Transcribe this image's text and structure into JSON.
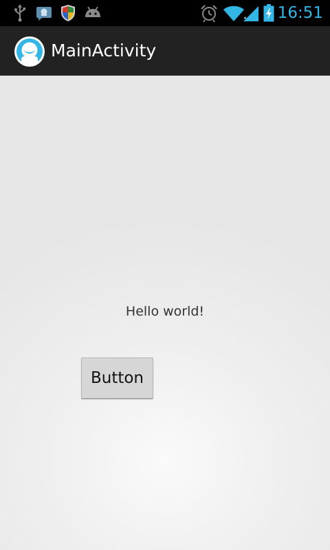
{
  "status_bar": {
    "time": "16:51",
    "left_icons": [
      "usb-icon",
      "chat-notification-icon",
      "shield-icon",
      "android-debug-icon"
    ],
    "right_icons": [
      "alarm-clock-icon",
      "wifi-icon",
      "cell-signal-icon",
      "battery-charging-icon"
    ],
    "clock_color": "#33b5e5"
  },
  "action_bar": {
    "title": "MainActivity",
    "icon": "app-face-icon",
    "background": "#222222"
  },
  "content": {
    "hello_text": "Hello world!",
    "button_label": "Button"
  }
}
